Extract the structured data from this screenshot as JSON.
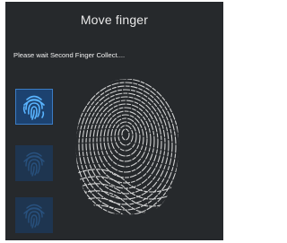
{
  "dialog": {
    "title": "Move finger",
    "status": "Please wait Second Finger Collect....",
    "slots": [
      {
        "state": "captured",
        "icon": "fingerprint-icon"
      },
      {
        "state": "pending",
        "icon": "fingerprint-icon"
      },
      {
        "state": "pending",
        "icon": "fingerprint-icon"
      }
    ]
  },
  "colors": {
    "background": "#26292c",
    "accent": "#3b9bff",
    "slot_pending": "#1e3550",
    "fingerprint_ridges": "#e6e6e6"
  }
}
